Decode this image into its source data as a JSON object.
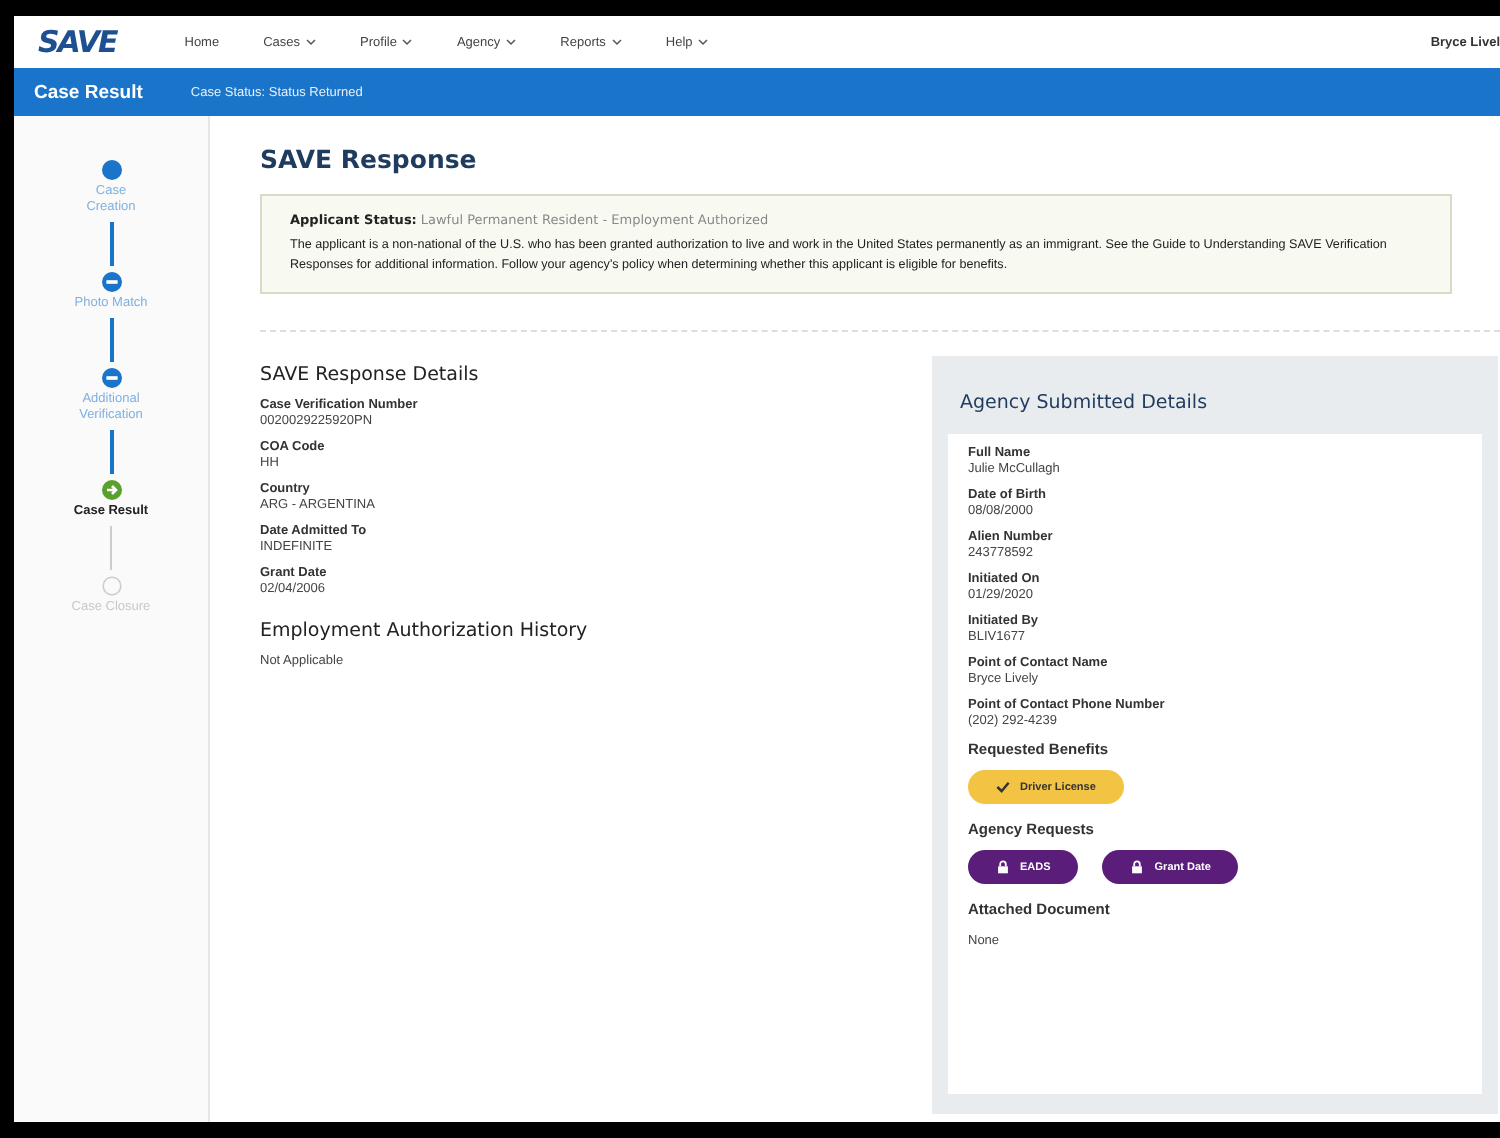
{
  "nav": {
    "logo": "SAVE",
    "items": [
      {
        "label": "Home",
        "dropdown": false
      },
      {
        "label": "Cases",
        "dropdown": true
      },
      {
        "label": "Profile",
        "dropdown": true
      },
      {
        "label": "Agency",
        "dropdown": true
      },
      {
        "label": "Reports",
        "dropdown": true
      },
      {
        "label": "Help",
        "dropdown": true
      }
    ],
    "user": "Bryce Livel"
  },
  "subbar": {
    "title": "Case Result",
    "status": "Case Status: Status Returned"
  },
  "steps": [
    {
      "label": "Case Creation",
      "kind": "done"
    },
    {
      "label": "Photo Match",
      "kind": "skipped"
    },
    {
      "label": "Additional Verification",
      "kind": "skipped"
    },
    {
      "label": "Case Result",
      "kind": "current"
    },
    {
      "label": "Case Closure",
      "kind": "pending"
    }
  ],
  "response": {
    "title": "SAVE Response",
    "status_label": "Applicant Status:",
    "status_value": "Lawful Permanent Resident - Employment Authorized",
    "message": "The applicant is a non-national of the U.S. who has been granted authorization to live and work in the United States permanently as an immigrant. See the Guide to Understanding SAVE Verification Responses for additional information. Follow your agency's policy when determining whether this applicant is eligible for benefits."
  },
  "details": {
    "title": "SAVE Response Details",
    "fields": [
      {
        "label": "Case Verification Number",
        "value": "0020029225920PN"
      },
      {
        "label": "COA Code",
        "value": "HH"
      },
      {
        "label": "Country",
        "value": "ARG - ARGENTINA"
      },
      {
        "label": "Date Admitted To",
        "value": "INDEFINITE"
      },
      {
        "label": "Grant Date",
        "value": "02/04/2006"
      }
    ],
    "history_title": "Employment Authorization History",
    "history_value": "Not Applicable"
  },
  "agency": {
    "title": "Agency Submitted Details",
    "fields": [
      {
        "label": "Full Name",
        "value": "Julie McCullagh"
      },
      {
        "label": "Date of Birth",
        "value": "08/08/2000"
      },
      {
        "label": "Alien Number",
        "value": "243778592"
      },
      {
        "label": "Initiated On",
        "value": "01/29/2020"
      },
      {
        "label": "Initiated By",
        "value": "BLIV1677"
      },
      {
        "label": "Point of Contact Name",
        "value": "Bryce Lively"
      },
      {
        "label": "Point of Contact Phone Number",
        "value": "(202) 292-4239"
      }
    ],
    "benefits_label": "Requested Benefits",
    "benefits": [
      {
        "label": "Driver License"
      }
    ],
    "requests_label": "Agency Requests",
    "requests": [
      {
        "label": "EADS"
      },
      {
        "label": "Grant Date"
      }
    ],
    "attached_label": "Attached Document",
    "attached_value": "None"
  }
}
